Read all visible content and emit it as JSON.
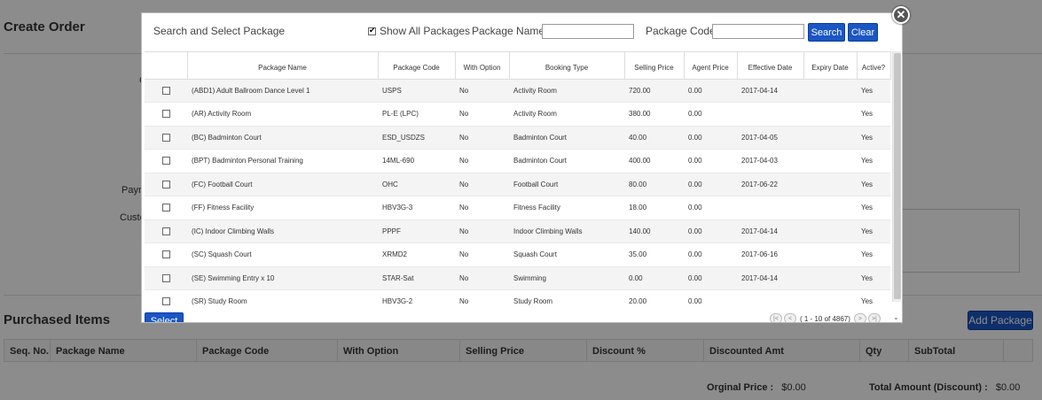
{
  "background": {
    "page_title": "Create Order",
    "labels": [
      {
        "text": "C",
        "key": "c"
      },
      {
        "text": "Paym",
        "key": "payment"
      },
      {
        "text": "Custo",
        "key": "customer"
      }
    ],
    "purchased_title": "Purchased Items",
    "add_package_label": "Add Package",
    "table_headers": [
      "Seq. No.",
      "Package Name",
      "Package Code",
      "With Option",
      "Selling Price",
      "Discount %",
      "Discounted Amt",
      "Qty",
      "SubTotal"
    ],
    "original_price_label": "Orginal Price :",
    "original_price_value": "$0.00",
    "total_amount_label": "Total Amount (Discount) :",
    "total_amount_value": "$0.00"
  },
  "dialog": {
    "title": "Search and Select Package",
    "show_all_label": "Show All Packages",
    "show_all_checked": true,
    "package_name_label": "Package Name:",
    "package_name_value": "",
    "package_code_label": "Package Code:",
    "package_code_value": "",
    "search_label": "Search",
    "clear_label": "Clear",
    "close_glyph": "✕",
    "select_label": "Select",
    "pager_info": "( 1 - 10 of 4867)",
    "pager_icons": [
      "first-page-icon",
      "prev-page-icon",
      "next-page-icon",
      "last-page-icon"
    ],
    "columns": [
      "Package Name",
      "Package Code",
      "With Option",
      "Booking Type",
      "Selling Price",
      "Agent Price",
      "Effective Date",
      "Expiry Date",
      "Active?"
    ],
    "rows": [
      {
        "name": "(ABD1) Adult Ballroom Dance Level 1",
        "code": "USPS",
        "option": "No",
        "type": "Activity Room",
        "selling": "720.00",
        "agent": "0.00",
        "effective": "2017-04-14",
        "expiry": "",
        "active": "Yes"
      },
      {
        "name": "(AR) Activity Room",
        "code": "PL-E (LPC)",
        "option": "No",
        "type": "Activity Room",
        "selling": "380.00",
        "agent": "0.00",
        "effective": "",
        "expiry": "",
        "active": "Yes"
      },
      {
        "name": "(BC) Badminton Court",
        "code": "ESD_USDZS",
        "option": "No",
        "type": "Badminton Court",
        "selling": "40.00",
        "agent": "0.00",
        "effective": "2017-04-05",
        "expiry": "",
        "active": "Yes"
      },
      {
        "name": "(BPT) Badminton Personal Training",
        "code": "14ML-690",
        "option": "No",
        "type": "Badminton Court",
        "selling": "400.00",
        "agent": "0.00",
        "effective": "2017-04-03",
        "expiry": "",
        "active": "Yes"
      },
      {
        "name": "(FC) Football Court",
        "code": "OHC",
        "option": "No",
        "type": "Football Court",
        "selling": "80.00",
        "agent": "0.00",
        "effective": "2017-06-22",
        "expiry": "",
        "active": "Yes"
      },
      {
        "name": "(FF) Fitness Facility",
        "code": "HBV3G-3",
        "option": "No",
        "type": "Fitness Facility",
        "selling": "18.00",
        "agent": "0.00",
        "effective": "",
        "expiry": "",
        "active": "Yes"
      },
      {
        "name": "(IC) Indoor Climbing Walls",
        "code": "PPPF",
        "option": "No",
        "type": "Indoor Climbing Walls",
        "selling": "140.00",
        "agent": "0.00",
        "effective": "2017-04-14",
        "expiry": "",
        "active": "Yes"
      },
      {
        "name": "(SC) Squash Court",
        "code": "XRMD2",
        "option": "No",
        "type": "Squash Court",
        "selling": "35.00",
        "agent": "0.00",
        "effective": "2017-06-16",
        "expiry": "",
        "active": "Yes"
      },
      {
        "name": "(SE) Swimming Entry x 10",
        "code": "STAR-Sat",
        "option": "No",
        "type": "Swimming",
        "selling": "0.00",
        "agent": "0.00",
        "effective": "2017-04-14",
        "expiry": "",
        "active": "Yes"
      },
      {
        "name": "(SR) Study Room",
        "code": "HBV3G-2",
        "option": "No",
        "type": "Study Room",
        "selling": "20.00",
        "agent": "0.00",
        "effective": "",
        "expiry": "",
        "active": "Yes"
      }
    ]
  },
  "colors": {
    "accent": "#1a56c4",
    "overlay": "#737373"
  }
}
